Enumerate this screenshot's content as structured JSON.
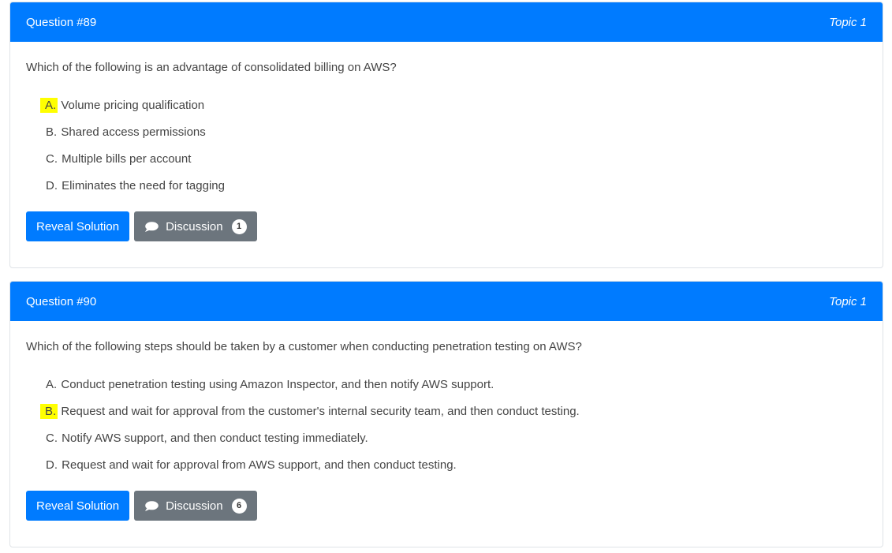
{
  "questions": [
    {
      "number": "Question #89",
      "topic": "Topic 1",
      "text": "Which of the following is an advantage of consolidated billing on AWS?",
      "choices": [
        {
          "letter": "A.",
          "text": " Volume pricing qualification",
          "highlighted": true
        },
        {
          "letter": "B.",
          "text": " Shared access permissions",
          "highlighted": false
        },
        {
          "letter": "C.",
          "text": " Multiple bills per account",
          "highlighted": false
        },
        {
          "letter": "D.",
          "text": " Eliminates the need for tagging",
          "highlighted": false
        }
      ],
      "reveal_label": "Reveal Solution",
      "discussion_label": "Discussion",
      "discussion_count": "1"
    },
    {
      "number": "Question #90",
      "topic": "Topic 1",
      "text": "Which of the following steps should be taken by a customer when conducting penetration testing on AWS?",
      "choices": [
        {
          "letter": "A.",
          "text": " Conduct penetration testing using Amazon Inspector, and then notify AWS support.",
          "highlighted": false
        },
        {
          "letter": "B.",
          "text": " Request and wait for approval from the customer's internal security team, and then conduct testing.",
          "highlighted": true
        },
        {
          "letter": "C.",
          "text": " Notify AWS support, and then conduct testing immediately.",
          "highlighted": false
        },
        {
          "letter": "D.",
          "text": " Request and wait for approval from AWS support, and then conduct testing.",
          "highlighted": false
        }
      ],
      "reveal_label": "Reveal Solution",
      "discussion_label": "Discussion",
      "discussion_count": "6"
    }
  ],
  "colors": {
    "header_bg": "#007bff",
    "highlight": "#ffff00",
    "secondary_btn": "#6c757d"
  },
  "icons": {
    "discussion": "speech-bubble-icon"
  }
}
